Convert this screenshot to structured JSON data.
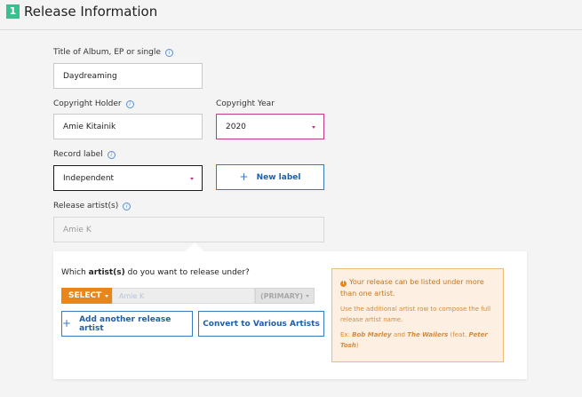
{
  "header": {
    "step_number": "1",
    "title": "Release Information"
  },
  "title_field": {
    "label": "Title of Album, EP or single",
    "value": "Daydreaming"
  },
  "copyright_holder": {
    "label": "Copyright Holder",
    "value": "Amie Kitainik"
  },
  "copyright_year": {
    "label": "Copyright Year",
    "value": "2020"
  },
  "record_label": {
    "label": "Record label",
    "value": "Independent"
  },
  "new_label_button": {
    "label": "New label"
  },
  "release_artists": {
    "label": "Release artist(s)",
    "value": "Amie K"
  },
  "artist_panel": {
    "question_prefix": "Which ",
    "question_bold": "artist(s)",
    "question_suffix": " do you want to release under?",
    "select_label": "SELECT",
    "artist_value": "Amie K",
    "primary_label": "(PRIMARY)",
    "add_artist_label": "Add another release artist",
    "convert_label": "Convert to Various Artists"
  },
  "tip": {
    "heading": "Your release can be listed under more than one artist.",
    "body": "Use the additional artist row to compose the full release artist name.",
    "example_prefix": "Ex: ",
    "example_artist1": "Bob Marley",
    "example_and": " and ",
    "example_artist2": "The Wailers",
    "example_feat_open": " (feat. ",
    "example_artist3": "Peter Tosh",
    "example_close": ")"
  },
  "colors": {
    "accent_orange": "#e8861a",
    "link_blue": "#3a78c2",
    "year_border": "#c0398a",
    "step_badge": "#3bbf8f"
  },
  "icons": [
    "info-icon",
    "plus-icon",
    "warning-icon",
    "caret-down-icon"
  ]
}
